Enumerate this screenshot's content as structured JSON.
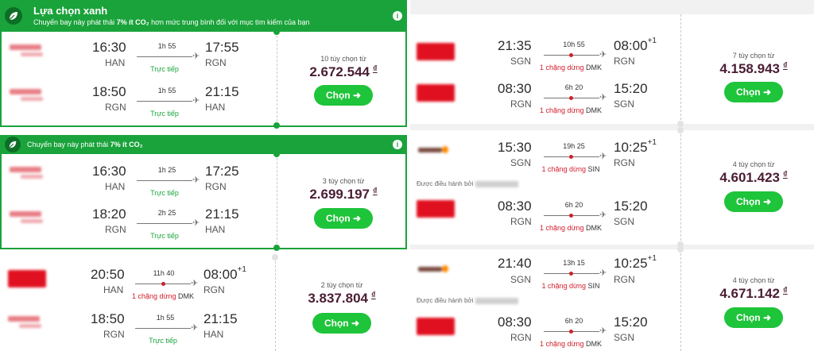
{
  "left": {
    "banner1": {
      "title": "Lựa chọn xanh",
      "subtitle_pre": "Chuyến bay này phát thải ",
      "subtitle_bold": "7% ít CO₂",
      "subtitle_post": " hơn mức trung bình đối với mục tìm kiếm của bạn"
    },
    "banner2": {
      "subtitle_pre": "Chuyến bay này phát thải ",
      "subtitle_bold": "7% ít CO₂"
    },
    "cards": [
      {
        "legs": [
          {
            "dep_time": "16:30",
            "dep_apt": "HAN",
            "arr_time": "17:55",
            "arr_apt": "RGN",
            "duration": "1h 55",
            "stops": "Trực tiếp"
          },
          {
            "dep_time": "18:50",
            "dep_apt": "RGN",
            "arr_time": "21:15",
            "arr_apt": "HAN",
            "duration": "1h 55",
            "stops": "Trực tiếp"
          }
        ],
        "options": "10 tùy chọn từ",
        "price": "2.672.544",
        "currency": "₫",
        "button": "Chọn"
      },
      {
        "legs": [
          {
            "dep_time": "16:30",
            "dep_apt": "HAN",
            "arr_time": "17:25",
            "arr_apt": "RGN",
            "duration": "1h 25",
            "stops": "Trực tiếp"
          },
          {
            "dep_time": "18:20",
            "dep_apt": "RGN",
            "arr_time": "21:15",
            "arr_apt": "HAN",
            "duration": "2h 25",
            "stops": "Trực tiếp"
          }
        ],
        "options": "3 tùy chọn từ",
        "price": "2.699.197",
        "currency": "₫",
        "button": "Chọn"
      },
      {
        "legs": [
          {
            "dep_time": "20:50",
            "dep_apt": "HAN",
            "arr_time": "08:00",
            "arr_sup": "+1",
            "arr_apt": "RGN",
            "duration": "11h 40",
            "stops_pre": "1 chặng dừng",
            "stops_via": "DMK"
          },
          {
            "dep_time": "18:50",
            "dep_apt": "RGN",
            "arr_time": "21:15",
            "arr_apt": "HAN",
            "duration": "1h 55",
            "stops": "Trực tiếp"
          }
        ],
        "options": "2 tùy chọn từ",
        "price": "3.837.804",
        "currency": "₫",
        "button": "Chọn"
      }
    ]
  },
  "right": {
    "cards": [
      {
        "legs": [
          {
            "dep_time": "21:35",
            "dep_apt": "SGN",
            "arr_time": "08:00",
            "arr_sup": "+1",
            "arr_apt": "RGN",
            "duration": "10h 55",
            "stops_pre": "1 chặng dừng",
            "stops_via": "DMK"
          },
          {
            "dep_time": "08:30",
            "dep_apt": "RGN",
            "arr_time": "15:20",
            "arr_apt": "SGN",
            "duration": "6h 20",
            "stops_pre": "1 chặng dừng",
            "stops_via": "DMK"
          }
        ],
        "options": "7 tùy chọn từ",
        "price": "4.158.943",
        "currency": "₫",
        "button": "Chọn"
      },
      {
        "legs": [
          {
            "dep_time": "15:30",
            "dep_apt": "SGN",
            "arr_time": "10:25",
            "arr_sup": "+1",
            "arr_apt": "RGN",
            "duration": "19h 25",
            "stops_pre": "1 chặng dừng",
            "stops_via": "SIN"
          },
          {
            "dep_time": "08:30",
            "dep_apt": "RGN",
            "arr_time": "15:20",
            "arr_apt": "SGN",
            "duration": "6h 20",
            "stops_pre": "1 chặng dừng",
            "stops_via": "DMK"
          }
        ],
        "operated_by": "Được điều hành bởi",
        "options": "4 tùy chọn từ",
        "price": "4.601.423",
        "currency": "₫",
        "button": "Chọn"
      },
      {
        "legs": [
          {
            "dep_time": "21:40",
            "dep_apt": "SGN",
            "arr_time": "10:25",
            "arr_sup": "+1",
            "arr_apt": "RGN",
            "duration": "13h 15",
            "stops_pre": "1 chặng dừng",
            "stops_via": "SIN"
          },
          {
            "dep_time": "08:30",
            "dep_apt": "RGN",
            "arr_time": "15:20",
            "arr_apt": "SGN",
            "duration": "6h 20",
            "stops_pre": "1 chặng dừng",
            "stops_via": "DMK"
          }
        ],
        "operated_by": "Được điều hành bởi",
        "options": "4 tùy chọn từ",
        "price": "4.671.142",
        "currency": "₫",
        "button": "Chọn"
      }
    ]
  },
  "icons": {
    "leaf": "leaf-icon",
    "info": "info-icon",
    "plane": "plane-icon",
    "arrow": "arrow-right-icon"
  },
  "colors": {
    "green": "#1aa33b",
    "button": "#1ec43a",
    "price": "#4a1d33",
    "stop_red": "#d21e2b"
  }
}
